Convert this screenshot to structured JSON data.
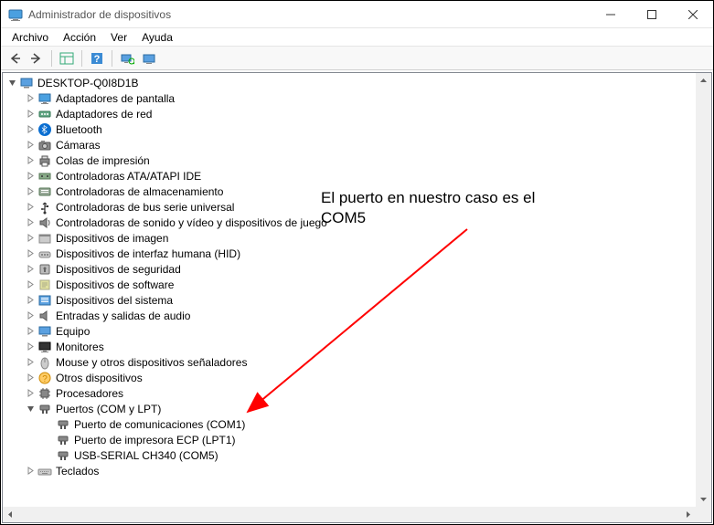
{
  "window": {
    "title": "Administrador de dispositivos"
  },
  "menubar": {
    "items": [
      "Archivo",
      "Acción",
      "Ver",
      "Ayuda"
    ]
  },
  "tree": {
    "root": "DESKTOP-Q0I8D1B",
    "categories": [
      {
        "label": "Adaptadores de pantalla",
        "icon": "display"
      },
      {
        "label": "Adaptadores de red",
        "icon": "network"
      },
      {
        "label": "Bluetooth",
        "icon": "bluetooth"
      },
      {
        "label": "Cámaras",
        "icon": "camera"
      },
      {
        "label": "Colas de impresión",
        "icon": "printer"
      },
      {
        "label": "Controladoras ATA/ATAPI IDE",
        "icon": "ide"
      },
      {
        "label": "Controladoras de almacenamiento",
        "icon": "storage"
      },
      {
        "label": "Controladoras de bus serie universal",
        "icon": "usb"
      },
      {
        "label": "Controladoras de sonido y vídeo y dispositivos de juego",
        "icon": "sound"
      },
      {
        "label": "Dispositivos de imagen",
        "icon": "imaging"
      },
      {
        "label": "Dispositivos de interfaz humana (HID)",
        "icon": "hid"
      },
      {
        "label": "Dispositivos de seguridad",
        "icon": "security"
      },
      {
        "label": "Dispositivos de software",
        "icon": "software"
      },
      {
        "label": "Dispositivos del sistema",
        "icon": "system"
      },
      {
        "label": "Entradas y salidas de audio",
        "icon": "audio"
      },
      {
        "label": "Equipo",
        "icon": "computer"
      },
      {
        "label": "Monitores",
        "icon": "monitor"
      },
      {
        "label": "Mouse y otros dispositivos señaladores",
        "icon": "mouse"
      },
      {
        "label": "Otros dispositivos",
        "icon": "other"
      },
      {
        "label": "Procesadores",
        "icon": "cpu"
      },
      {
        "label": "Puertos (COM y LPT)",
        "icon": "port",
        "expanded": true,
        "children": [
          {
            "label": "Puerto de comunicaciones (COM1)",
            "icon": "port"
          },
          {
            "label": "Puerto de impresora ECP (LPT1)",
            "icon": "port"
          },
          {
            "label": "USB-SERIAL CH340 (COM5)",
            "icon": "port"
          }
        ]
      },
      {
        "label": "Teclados",
        "icon": "keyboard"
      }
    ]
  },
  "annotation": {
    "line1": "El puerto en nuestro caso es el",
    "line2": "COM5"
  }
}
